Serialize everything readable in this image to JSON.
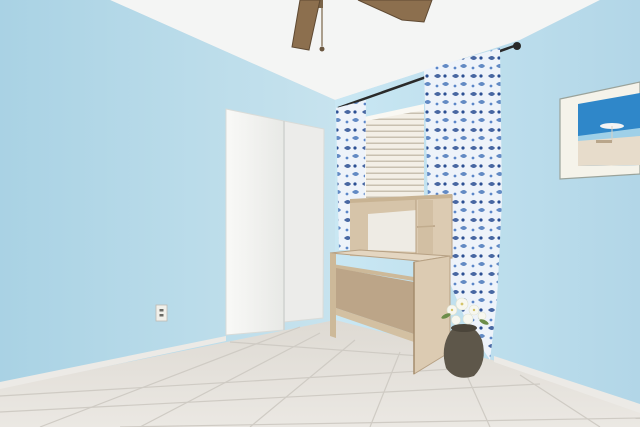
{
  "scene": {
    "colors": {
      "wall_left": "#b9dbe9",
      "wall_right": "#bfe0ef",
      "ceiling": "#f4f5f4",
      "floor": "#e6e4df",
      "tile_line": "#cfcbc4",
      "baseboard": "#eceae6",
      "closet_door": "#f6f6f4",
      "desk_wood": "#dccbb2",
      "desk_shadow": "#b7a184",
      "curtain_base": "#eef3fa",
      "curtain_pattern": "#2b4f93",
      "fan_blade": "#8c6f4e",
      "vase": "#5e574a",
      "flowers": "#f7f7ef",
      "artwork_frame": "#f5f3ea",
      "artwork_sky": "#2f87c9",
      "artwork_sand": "#e7dccb",
      "outlet": "#f1f0ea"
    }
  }
}
